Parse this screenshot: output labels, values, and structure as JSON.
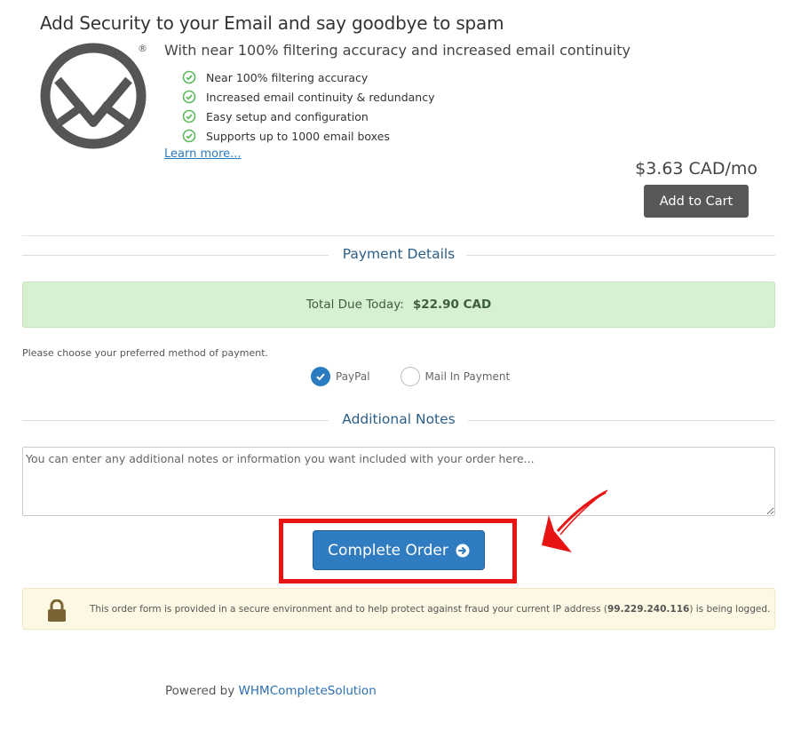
{
  "promo": {
    "title": "Add Security to your Email and say goodbye to spam",
    "subtitle": "With near 100% filtering accuracy and increased email continuity",
    "features": [
      "Near 100% filtering accuracy",
      "Increased email continuity & redundancy",
      "Easy setup and configuration",
      "Supports up to 1000 email boxes"
    ],
    "learn_more": "Learn more...",
    "price": "$3.63 CAD/mo",
    "add_to_cart": "Add to Cart",
    "logo_icon": "envelope-circle-logo",
    "registered_mark": "®"
  },
  "payment": {
    "heading": "Payment Details",
    "total_label": "Total Due Today:",
    "total_value": "$22.90 CAD",
    "prompt": "Please choose your preferred method of payment.",
    "options": [
      {
        "label": "PayPal",
        "selected": true
      },
      {
        "label": "Mail In Payment",
        "selected": false
      }
    ]
  },
  "notes": {
    "heading": "Additional Notes",
    "placeholder": "You can enter any additional notes or information you want included with your order here..."
  },
  "order": {
    "complete_label": "Complete Order"
  },
  "security": {
    "text_before": "This order form is provided in a secure environment and to help protect against fraud your current IP address (",
    "ip": "99.229.240.116",
    "text_after": ") is being logged."
  },
  "footer": {
    "powered_by": "Powered by",
    "brand": "WHMCompleteSolution"
  },
  "colors": {
    "accent": "#2f7cc1",
    "success_bg": "#d8f0d2",
    "check_green": "#5cb85c",
    "highlight_red": "#e81414",
    "warning_bg": "#fdf8e3"
  }
}
